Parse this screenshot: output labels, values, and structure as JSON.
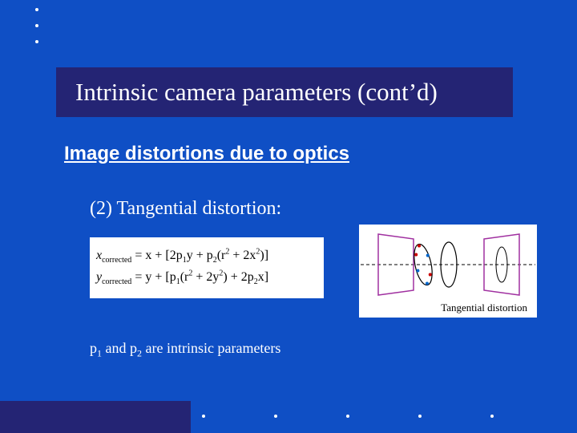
{
  "title": "Intrinsic camera parameters (cont’d)",
  "subheading": "Image distortions due to optics",
  "item": "(2) Tangential distortion:",
  "formula": {
    "line1_lhs": "x",
    "line1_sub": "corrected",
    "line1_rhs_a": " = x + [2p",
    "line1_p1_sub": "1",
    "line1_rhs_b": "y + p",
    "line1_p2_sub": "2",
    "line1_rhs_c": "(r",
    "line1_r2_sup": "2",
    "line1_rhs_d": " + 2x",
    "line1_x2_sup": "2",
    "line1_rhs_e": ")]",
    "line2_lhs": "y",
    "line2_sub": "corrected",
    "line2_rhs_a": " = y + [p",
    "line2_p1_sub": "1",
    "line2_rhs_b": "(r",
    "line2_r2_sup": "2",
    "line2_rhs_c": " + 2y",
    "line2_y2_sup": "2",
    "line2_rhs_d": ") + 2p",
    "line2_p2_sub": "2",
    "line2_rhs_e": "x]"
  },
  "note": {
    "a": "p",
    "s1": "1",
    "b": " and p",
    "s2": "2",
    "c": " are intrinsic parameters"
  },
  "diagram_caption": "Tangential distortion",
  "colors": {
    "slide_bg": "#0f4fc5",
    "bar_bg": "#242474",
    "white": "#ffffff"
  }
}
